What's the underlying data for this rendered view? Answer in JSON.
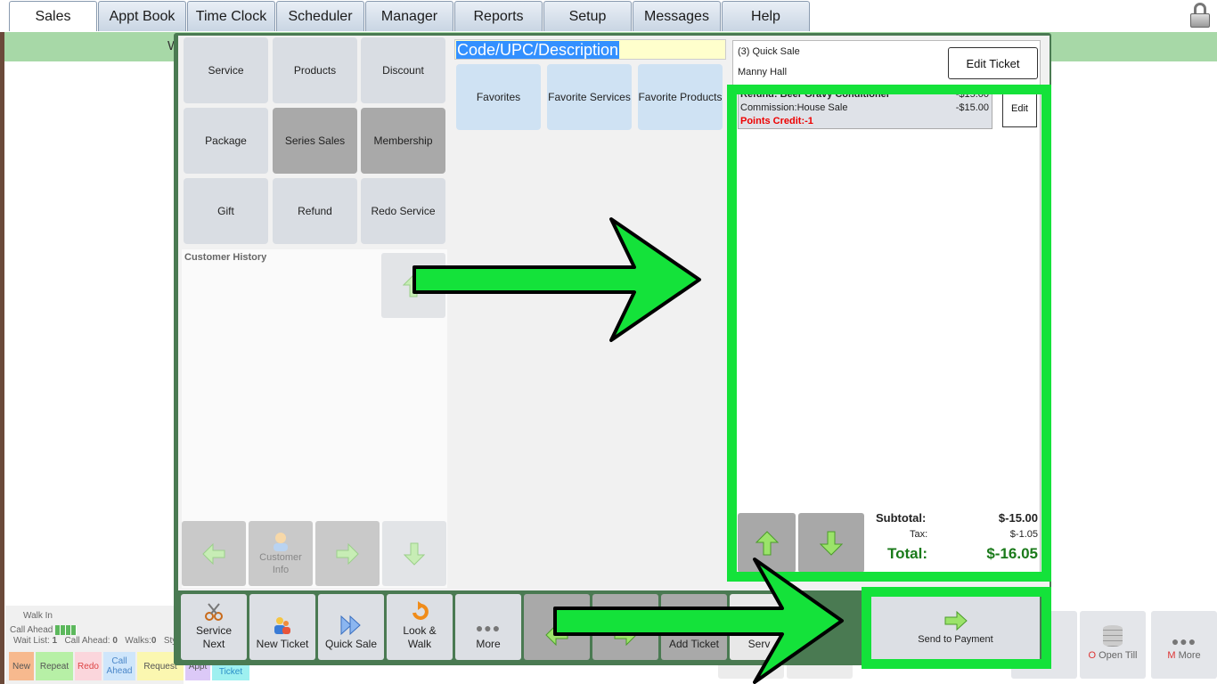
{
  "nav": {
    "tabs": [
      "Sales",
      "Appt Book",
      "Time Clock",
      "Scheduler",
      "Manager",
      "Reports",
      "Setup",
      "Messages",
      "Help"
    ],
    "active": "Sales"
  },
  "background": {
    "banner_letter": "W",
    "walk_in": "Walk In",
    "call_ahead": "Call Ahead",
    "wait_list_label": "Wait List:",
    "wait_list": "1",
    "call_ahead_label": "Call Ahead:",
    "call_ahead_count": "0",
    "walks_label": "Walks:",
    "walks": "0",
    "stylists": "Styli",
    "chips": [
      "New",
      "Repeat",
      "Redo",
      "Call Ahead",
      "Request",
      "Appt",
      "Ticket"
    ],
    "open_till_prefix": "O",
    "open_till": "Open Till",
    "more_prefix": "M",
    "more": "More",
    "amp": "&"
  },
  "categories": {
    "service": "Service",
    "products": "Products",
    "discount": "Discount",
    "package": "Package",
    "series_sales": "Series Sales",
    "membership": "Membership",
    "gift": "Gift",
    "refund": "Refund",
    "redo_service": "Redo Service"
  },
  "history": {
    "label": "Customer History",
    "customer_info": "Customer Info"
  },
  "search": {
    "value": "Code/UPC/Description"
  },
  "favorites": {
    "favorites": "Favorites",
    "favorite_services": "Favorite Services",
    "favorite_products": "Favorite Products"
  },
  "ticket": {
    "title": "(3) Quick Sale",
    "customer": "Manny Hall",
    "edit_ticket": "Edit Ticket",
    "line1_label": "Refund: Beer Gravy Conditioner",
    "line1_amount": "-$15.00",
    "line2_label": "Commission:House Sale",
    "line2_amount": "-$15.00",
    "points_credit": "Points Credit:-1",
    "edit": "Edit",
    "subtotal_label": "Subtotal:",
    "subtotal": "$-15.00",
    "tax_label": "Tax:",
    "tax": "$-1.05",
    "total_label": "Total:",
    "total": "$-16.05"
  },
  "toolbar": {
    "service_next": "Service Next",
    "new_ticket": "New Ticket",
    "quick_sale": "Quick Sale",
    "look_walk": "Look & Walk",
    "more": "More",
    "add_ticket": "Add Ticket",
    "return_service": "Retu Serv",
    "send_to_payment": "Send to Payment"
  },
  "colors": {
    "highlight": "#14e23a",
    "modal_frame": "#4a7a52",
    "total_green": "#1a7a1a",
    "points_red": "#e00000"
  }
}
